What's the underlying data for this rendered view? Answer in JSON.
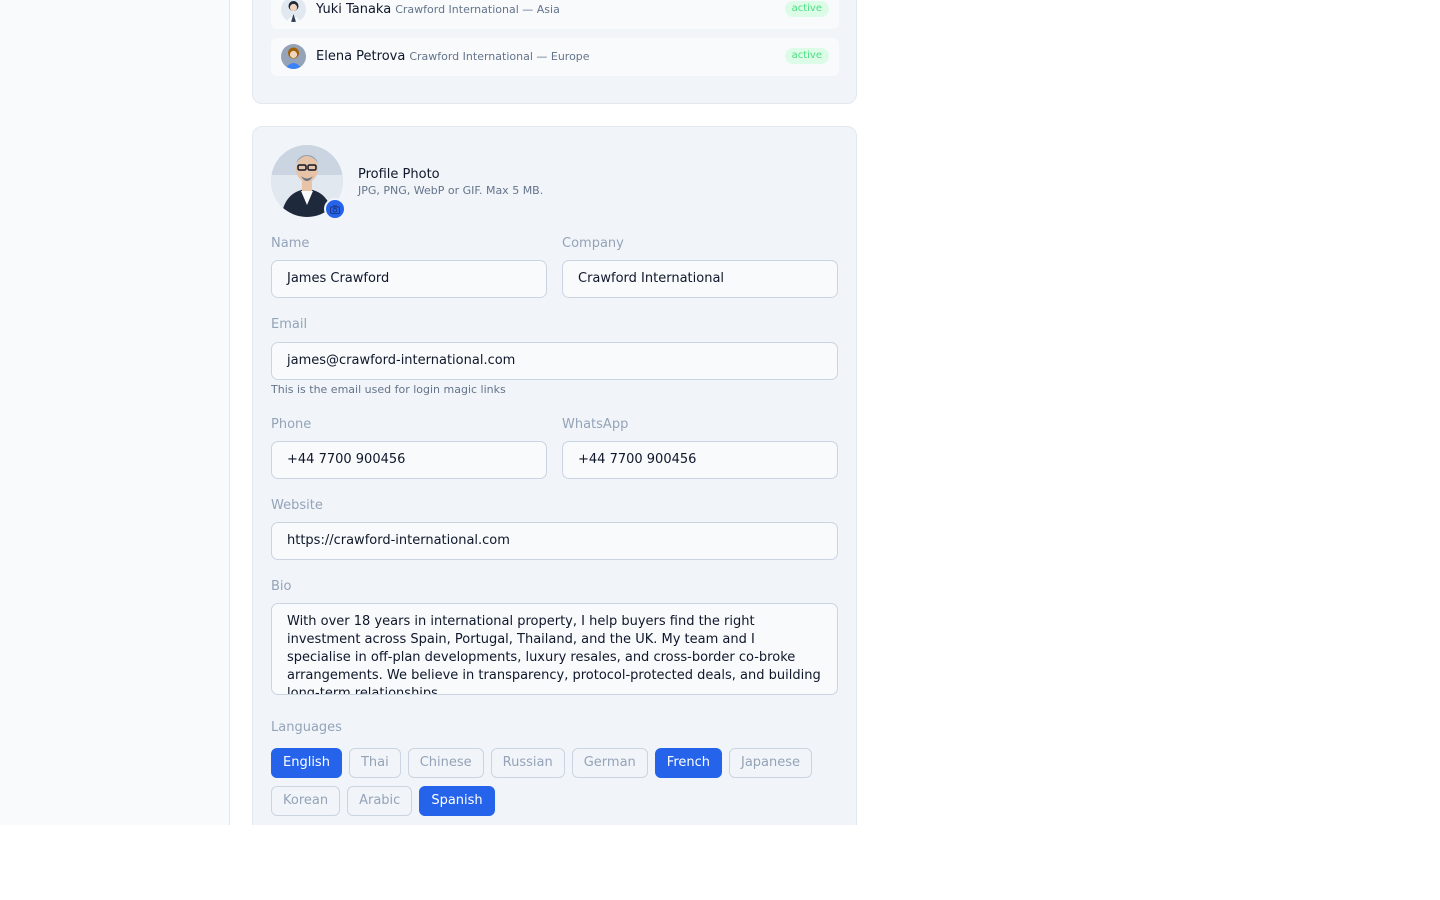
{
  "team": [
    {
      "name": "Yuki Tanaka",
      "org": "Crawford International — Asia",
      "status": "active"
    },
    {
      "name": "Elena Petrova",
      "org": "Crawford International — Europe",
      "status": "active"
    }
  ],
  "profile_photo": {
    "title": "Profile Photo",
    "hint": "JPG, PNG, WebP or GIF. Max 5 MB."
  },
  "form": {
    "name": {
      "label": "Name",
      "value": "James Crawford"
    },
    "company": {
      "label": "Company",
      "value": "Crawford International"
    },
    "email": {
      "label": "Email",
      "value": "james@crawford-international.com",
      "hint": "This is the email used for login magic links"
    },
    "phone": {
      "label": "Phone",
      "value": "+44 7700 900456"
    },
    "whatsapp": {
      "label": "WhatsApp",
      "value": "+44 7700 900456"
    },
    "website": {
      "label": "Website",
      "value": "https://crawford-international.com"
    },
    "bio": {
      "label": "Bio",
      "value": "With over 18 years in international property, I help buyers find the right investment across Spain, Portugal, Thailand, and the UK. My team and I specialise in off-plan developments, luxury resales, and cross-border co-broke arrangements. We believe in transparency, protocol-protected deals, and building long-term relationships."
    },
    "languages": {
      "label": "Languages",
      "options": [
        {
          "name": "English",
          "selected": true
        },
        {
          "name": "Thai",
          "selected": false
        },
        {
          "name": "Chinese",
          "selected": false
        },
        {
          "name": "Russian",
          "selected": false
        },
        {
          "name": "German",
          "selected": false
        },
        {
          "name": "French",
          "selected": true
        },
        {
          "name": "Japanese",
          "selected": false
        },
        {
          "name": "Korean",
          "selected": false
        },
        {
          "name": "Arabic",
          "selected": false
        },
        {
          "name": "Spanish",
          "selected": true
        }
      ]
    }
  },
  "colors": {
    "accent": "#2563eb",
    "active_badge_bg": "#dcfce7",
    "active_badge_text": "#4ade80"
  }
}
